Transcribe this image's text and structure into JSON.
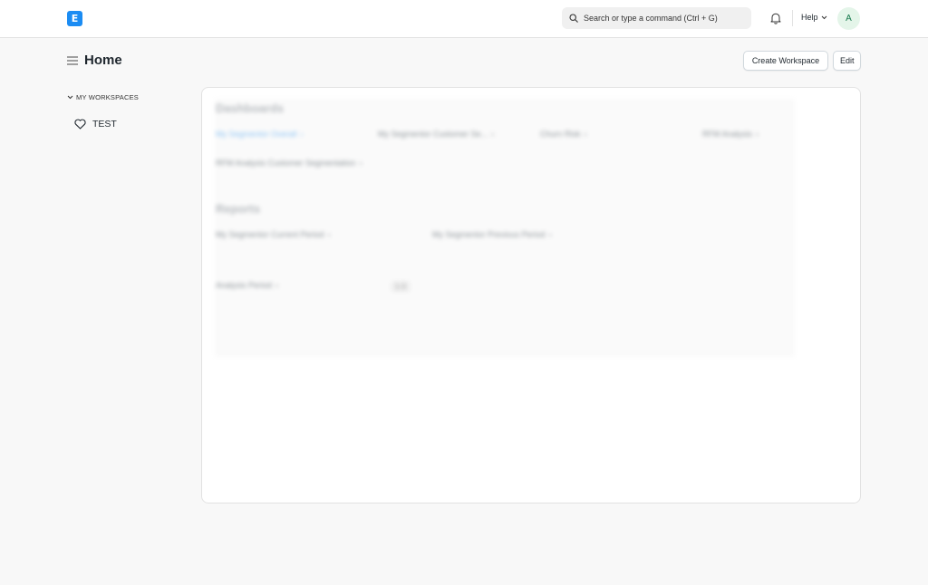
{
  "navbar": {
    "logo_letter": "E",
    "search_placeholder": "Search or type a command (Ctrl + G)",
    "help_label": "Help",
    "avatar_initial": "A"
  },
  "page": {
    "title": "Home",
    "create_workspace_label": "Create Workspace",
    "edit_label": "Edit"
  },
  "sidebar": {
    "section_label": "MY WORKSPACES",
    "items": [
      {
        "label": "TEST",
        "icon": "heart-icon"
      }
    ]
  },
  "workspace": {
    "dashboards_title": "Dashboards",
    "dashboards": [
      "My Segmentor Overall",
      "My Segmentor Customer Se...",
      "Churn Risk",
      "RFM Analysis",
      "RFM Analysis Customer Segmentation"
    ],
    "reports_title": "Reports",
    "reports": [
      "My Segmentor Current Period",
      "My Segmentor Previous Period"
    ],
    "extra": {
      "label": "Analysis Period",
      "pill": "1-3"
    }
  },
  "colors": {
    "accent": "#1b8cf3",
    "avatar_bg": "#e4f5e9",
    "avatar_fg": "#16794c"
  }
}
